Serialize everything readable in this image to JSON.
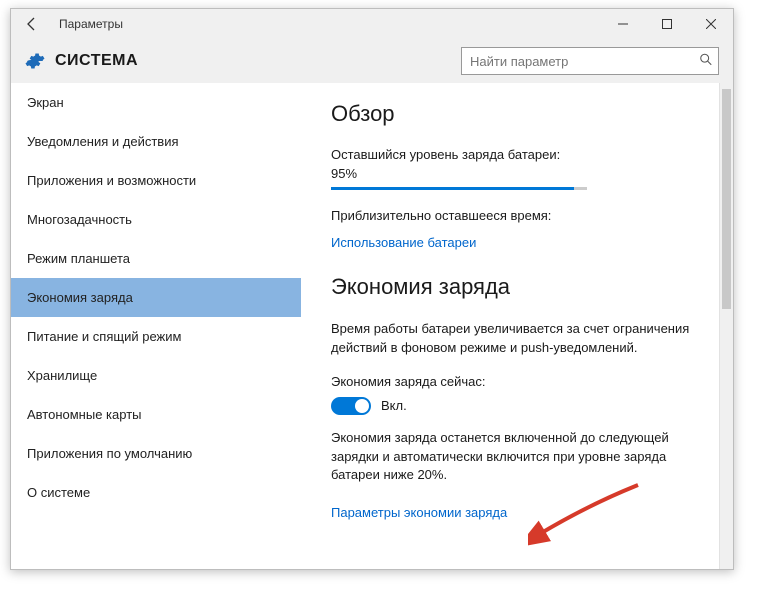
{
  "window": {
    "title": "Параметры"
  },
  "header": {
    "page_title": "СИСТЕМА",
    "search_placeholder": "Найти параметр"
  },
  "sidebar": {
    "items": [
      {
        "label": "Экран"
      },
      {
        "label": "Уведомления и действия"
      },
      {
        "label": "Приложения и возможности"
      },
      {
        "label": "Многозадачность"
      },
      {
        "label": "Режим планшета"
      },
      {
        "label": "Экономия заряда"
      },
      {
        "label": "Питание и спящий режим"
      },
      {
        "label": "Хранилище"
      },
      {
        "label": "Автономные карты"
      },
      {
        "label": "Приложения по умолчанию"
      },
      {
        "label": "О системе"
      }
    ],
    "selected_index": 5
  },
  "content": {
    "overview_title": "Обзор",
    "battery_remaining_label": "Оставшийся уровень заряда батареи:",
    "battery_percent": "95%",
    "battery_progress": 95,
    "time_remaining_label": "Приблизительно оставшееся время:",
    "battery_usage_link": "Использование батареи",
    "saver_title": "Экономия заряда",
    "saver_desc": "Время работы батареи увеличивается за счет ограничения действий в фоновом режиме и push-уведомлений.",
    "saver_now_label": "Экономия заряда сейчас:",
    "toggle_state_label": "Вкл.",
    "toggle_on": true,
    "saver_note": "Экономия заряда останется включенной до следующей зарядки и автоматически включится при уровне заряда батареи ниже 20%.",
    "saver_settings_link": "Параметры экономии заряда"
  },
  "colors": {
    "accent": "#0078d7",
    "link": "#0066cc",
    "selection": "#88b4e1",
    "arrow": "#d63a2a"
  }
}
